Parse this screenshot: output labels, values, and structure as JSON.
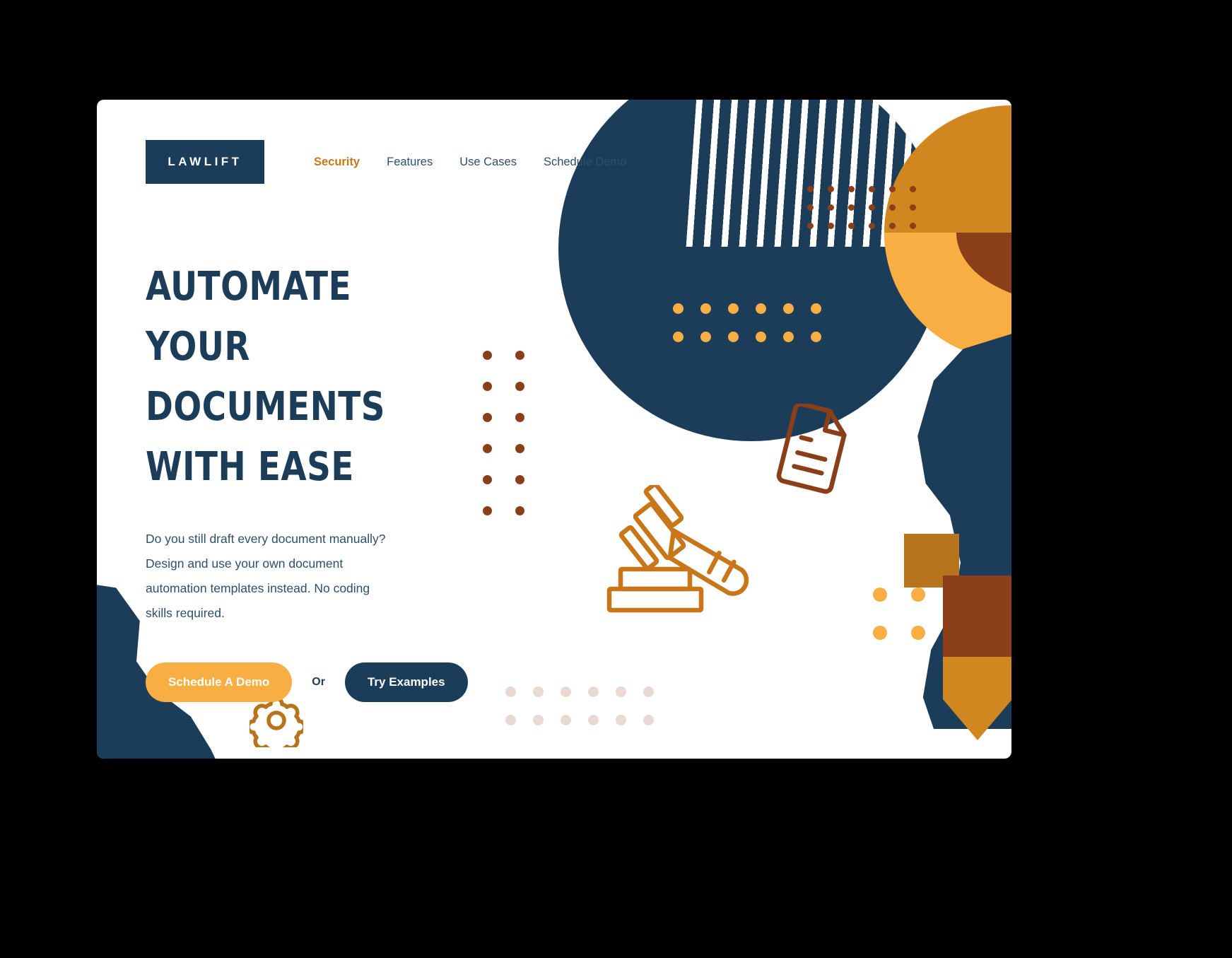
{
  "page": {
    "background_color": "#000000",
    "card_background": "#ffffff"
  },
  "brand": {
    "logo_text": "LAWLIFT",
    "logo_bg_color": "#1c3d5a"
  },
  "nav": {
    "items": [
      {
        "label": "Security",
        "active": true
      },
      {
        "label": "Features",
        "active": false
      },
      {
        "label": "Use Cases",
        "active": false
      },
      {
        "label": "Schedule Demo",
        "active": false
      }
    ],
    "active_color": "#c8761a",
    "inactive_color": "#2d4f6b"
  },
  "hero": {
    "headline_lines": [
      "AUTOMATE YOUR",
      "DOCUMENTS",
      "WITH EASE"
    ],
    "headline_text": "AUTOMATE YOUR DOCUMENTS WITH EASE",
    "subtext": "Do you still draft every document manually? Design and use your own document automation templates instead. No coding skills required.",
    "headline_color": "#1c3d5a",
    "subtext_color": "#2d4f6b"
  },
  "cta": {
    "primary_label": "Schedule A Demo",
    "primary_color": "#f8ae42",
    "separator_label": "Or",
    "secondary_label": "Try Examples",
    "secondary_color": "#1c3d5a"
  },
  "decor": {
    "navy": "#1c3d5a",
    "orange": "#f8ae42",
    "dark_orange": "#d1871f",
    "brown": "#8a3f18",
    "bronze": "#b8741c",
    "beige": "#e8dad2",
    "icons": [
      "gavel-icon",
      "document-icon",
      "gear-icon"
    ],
    "dot_grids": [
      {
        "name": "dots-brown-top",
        "cols": 6,
        "rows": 3,
        "color": "#8a3f18"
      },
      {
        "name": "dots-orange-mid",
        "cols": 6,
        "rows": 2,
        "color": "#f8ae42"
      },
      {
        "name": "dots-brown-left",
        "cols": 2,
        "rows": 6,
        "color": "#8a3f18"
      },
      {
        "name": "dots-orange-square",
        "cols": 2,
        "rows": 2,
        "color": "#f8ae42"
      },
      {
        "name": "dots-beige-bottom",
        "cols": 6,
        "rows": 2,
        "color": "#e8dad2"
      }
    ]
  }
}
